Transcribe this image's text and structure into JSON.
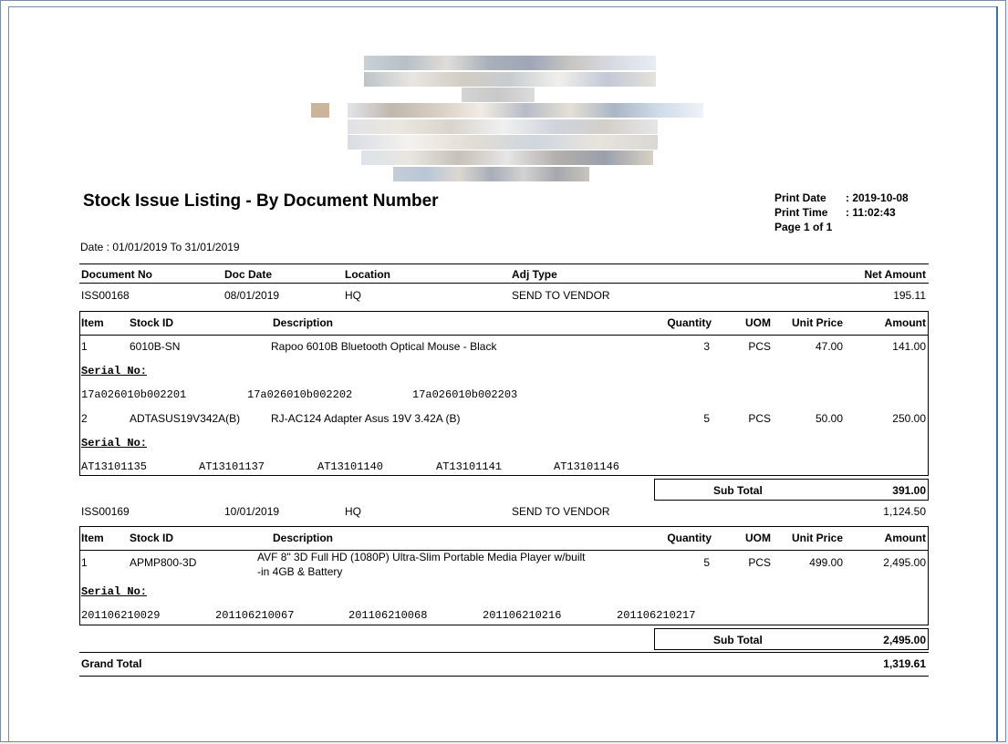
{
  "report": {
    "title": "Stock Issue Listing - By Document Number",
    "print_date_label": "Print Date",
    "print_date": ": 2019-10-08",
    "print_time_label": "Print Time",
    "print_time": ": 11:02:43",
    "page": "Page 1 of 1",
    "date_range": "Date : 01/01/2019 To 31/01/2019"
  },
  "header_cols": {
    "doc_no": "Document No",
    "doc_date": "Doc Date",
    "location": "Location",
    "adj_type": "Adj Type",
    "net_amount": "Net Amount"
  },
  "item_cols": {
    "item": "Item",
    "stock_id": "Stock ID",
    "description": "Description",
    "quantity": "Quantity",
    "uom": "UOM",
    "unit_price": "Unit Price",
    "amount": "Amount"
  },
  "serial_label": "Serial No:",
  "sub_total_label": "Sub Total",
  "grand_total_label": "Grand Total",
  "grand_total": "1,319.61",
  "documents": [
    {
      "doc_no": "ISS00168",
      "doc_date": "08/01/2019",
      "location": "HQ",
      "adj_type": "SEND TO VENDOR",
      "net_amount": "195.11",
      "sub_total": "391.00",
      "items": [
        {
          "item": "1",
          "stock_id": "6010B-SN",
          "description": "Rapoo 6010B Bluetooth Optical Mouse - Black",
          "quantity": "3",
          "uom": "PCS",
          "unit_price": "47.00",
          "amount": "141.00",
          "serials": [
            "17a026010b002201",
            "17a026010b002202",
            "17a026010b002203"
          ]
        },
        {
          "item": "2",
          "stock_id": "ADTASUS19V342A(B)",
          "description": "RJ-AC124 Adapter Asus 19V 3.42A (B)",
          "quantity": "5",
          "uom": "PCS",
          "unit_price": "50.00",
          "amount": "250.00",
          "serials": [
            "AT13101135",
            "AT13101137",
            "AT13101140",
            "AT13101141",
            "AT13101146"
          ]
        }
      ]
    },
    {
      "doc_no": "ISS00169",
      "doc_date": "10/01/2019",
      "location": "HQ",
      "adj_type": "SEND TO VENDOR",
      "net_amount": "1,124.50",
      "sub_total": "2,495.00",
      "items": [
        {
          "item": "1",
          "stock_id": "APMP800-3D",
          "description_line1": "AVF 8\" 3D Full HD (1080P) Ultra-Slim Portable Media Player w/built",
          "description_line2": "-in 4GB & Battery",
          "quantity": "5",
          "uom": "PCS",
          "unit_price": "499.00",
          "amount": "2,495.00",
          "serials": [
            "201106210029",
            "201106210067",
            "201106210068",
            "201106210216",
            "201106210217"
          ]
        }
      ]
    }
  ],
  "colors": {
    "frame_border": "#7a8ba6",
    "frame_accent": "#3d6fb6"
  },
  "logo_icon": "pixelated-company-logo"
}
